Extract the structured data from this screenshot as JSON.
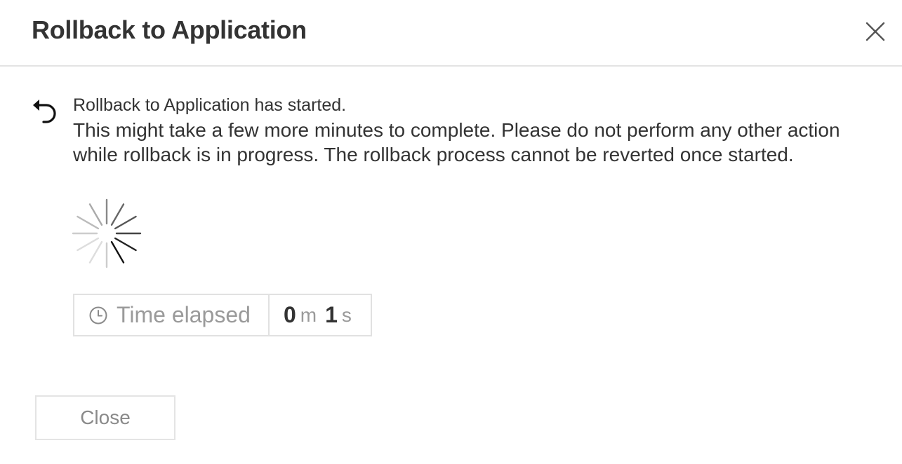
{
  "dialog": {
    "title": "Rollback to Application",
    "close_icon": "close-icon"
  },
  "message": {
    "icon": "undo-icon",
    "status": "Rollback to Application has started.",
    "body": "This might take a few more minutes to complete. Please do not perform any other action while rollback is in progress. The rollback process cannot be reverted once started."
  },
  "spinner": {
    "icon": "loading-spinner-icon"
  },
  "timer": {
    "icon": "clock-icon",
    "label": "Time elapsed",
    "minutes": "0",
    "minutes_unit": "m",
    "seconds": "1",
    "seconds_unit": "s"
  },
  "footer": {
    "close_label": "Close"
  }
}
